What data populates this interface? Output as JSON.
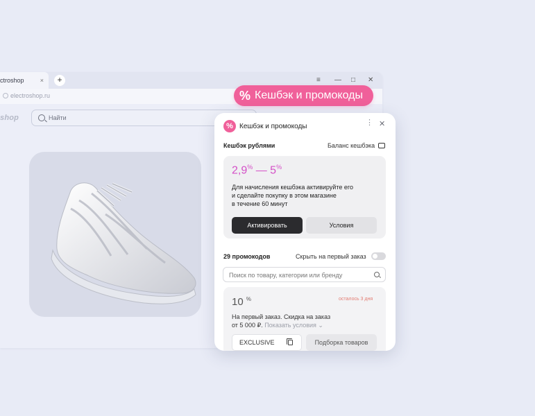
{
  "browser": {
    "tab_title": "ctroshop",
    "tab_close": "×",
    "new_tab": "+",
    "menu_icon": "≡",
    "minimize_icon": "—",
    "maximize_icon": "□",
    "close_icon": "✕",
    "url": "electroshop.ru"
  },
  "site": {
    "logo": "shop",
    "search_placeholder": "Найти"
  },
  "floating_badge": {
    "icon": "%",
    "label": "Кешбэк и промокоды"
  },
  "panel": {
    "title": "Кешбэк и промокоды",
    "more_icon": "⋮",
    "close_icon": "✕",
    "cashback_label": "Кешбэк рублями",
    "balance_link": "Баланс кешбэка",
    "rate_from": "2,9",
    "rate_to": "5",
    "rate_unit": "%",
    "rate_dash": "—",
    "description_lines": [
      "Для начисления кешбэка активируйте его",
      "и сделайте покупку в этом магазине",
      "в течение 60 минут"
    ],
    "activate_button": "Активировать",
    "conditions_button": "Условия",
    "promo_count": "29 промокодов",
    "hide_first_order": "Скрыть на первый заказ",
    "search_placeholder": "Поиск по товару, категории или бренду",
    "promo": {
      "value": "10",
      "unit": "%",
      "remaining": "осталось 3 дня",
      "line1": "На первый заказ.  Скидка на заказ",
      "line2": "от 5 000 ₽.",
      "show_conditions": "Показать условия ⌄",
      "code": "EXCLUSIVE",
      "selection_button": "Подборка товаров"
    }
  },
  "colors": {
    "accent_pink": "#f0609a",
    "rate_magenta": "#d44fc7",
    "background": "#e8ebf6"
  }
}
